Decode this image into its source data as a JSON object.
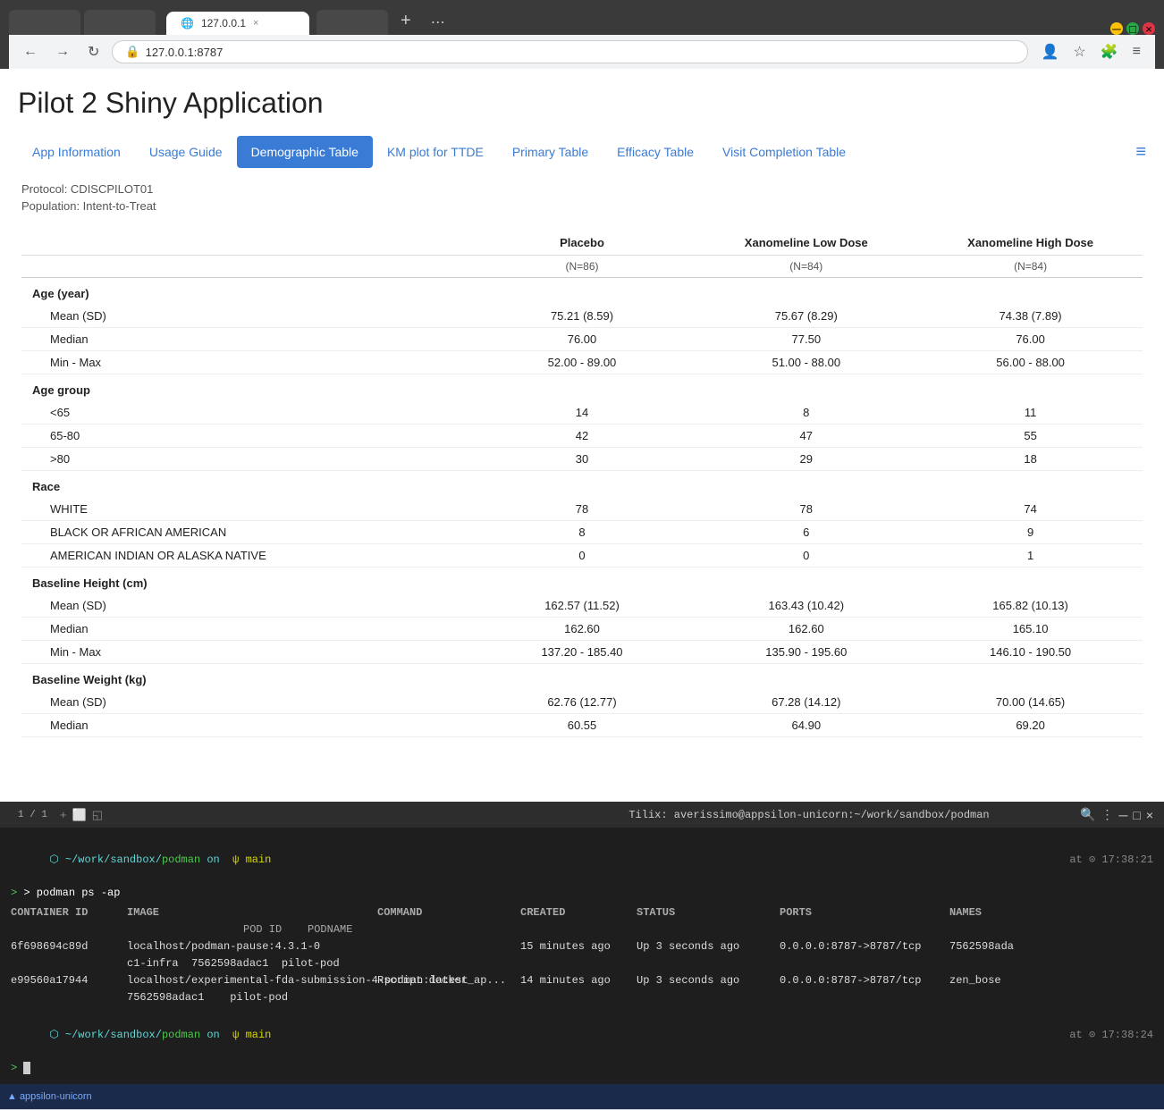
{
  "browser": {
    "tab_label": "127.0.0.1",
    "url": "127.0.0.1:8787",
    "tab_close": "×",
    "tab_new": "+",
    "tab_menu": "⋯",
    "nav_back": "←",
    "nav_forward": "→",
    "nav_refresh": "↻"
  },
  "app": {
    "title": "Pilot 2 Shiny Application",
    "tabs": [
      {
        "label": "App Information",
        "active": false
      },
      {
        "label": "Usage Guide",
        "active": false
      },
      {
        "label": "Demographic Table",
        "active": true
      },
      {
        "label": "KM plot for TTDE",
        "active": false
      },
      {
        "label": "Primary Table",
        "active": false
      },
      {
        "label": "Efficacy Table",
        "active": false
      },
      {
        "label": "Visit Completion Table",
        "active": false
      }
    ],
    "protocol": "Protocol: CDISCPILOT01",
    "population": "Population: Intent-to-Treat"
  },
  "table": {
    "columns": {
      "label": "",
      "placebo": "Placebo",
      "placebo_n": "(N=86)",
      "xan_low": "Xanomeline Low Dose",
      "xan_low_n": "(N=84)",
      "xan_high": "Xanomeline High Dose",
      "xan_high_n": "(N=84)"
    },
    "sections": [
      {
        "header": "Age (year)",
        "rows": [
          {
            "label": "Mean (SD)",
            "placebo": "75.21 (8.59)",
            "xan_low": "75.67 (8.29)",
            "xan_high": "74.38 (7.89)",
            "indented": true
          },
          {
            "label": "Median",
            "placebo": "76.00",
            "xan_low": "77.50",
            "xan_high": "76.00",
            "indented": true
          },
          {
            "label": "Min - Max",
            "placebo": "52.00 - 89.00",
            "xan_low": "51.00 - 88.00",
            "xan_high": "56.00 - 88.00",
            "indented": true
          }
        ]
      },
      {
        "header": "Age group",
        "rows": [
          {
            "label": "<65",
            "placebo": "14",
            "xan_low": "8",
            "xan_high": "11",
            "indented": true
          },
          {
            "label": "65-80",
            "placebo": "42",
            "xan_low": "47",
            "xan_high": "55",
            "indented": true
          },
          {
            "label": ">80",
            "placebo": "30",
            "xan_low": "29",
            "xan_high": "18",
            "indented": true
          }
        ]
      },
      {
        "header": "Race",
        "rows": [
          {
            "label": "WHITE",
            "placebo": "78",
            "xan_low": "78",
            "xan_high": "74",
            "indented": true
          },
          {
            "label": "BLACK OR AFRICAN AMERICAN",
            "placebo": "8",
            "xan_low": "6",
            "xan_high": "9",
            "indented": true
          },
          {
            "label": "AMERICAN INDIAN OR ALASKA NATIVE",
            "placebo": "0",
            "xan_low": "0",
            "xan_high": "1",
            "indented": true
          }
        ]
      },
      {
        "header": "Baseline Height (cm)",
        "rows": [
          {
            "label": "Mean (SD)",
            "placebo": "162.57 (11.52)",
            "xan_low": "163.43 (10.42)",
            "xan_high": "165.82 (10.13)",
            "indented": true
          },
          {
            "label": "Median",
            "placebo": "162.60",
            "xan_low": "162.60",
            "xan_high": "165.10",
            "indented": true
          },
          {
            "label": "Min - Max",
            "placebo": "137.20 - 185.40",
            "xan_low": "135.90 - 195.60",
            "xan_high": "146.10 - 190.50",
            "indented": true
          }
        ]
      },
      {
        "header": "Baseline Weight (kg)",
        "rows": [
          {
            "label": "Mean (SD)",
            "placebo": "62.76 (12.77)",
            "xan_low": "67.28 (14.12)",
            "xan_high": "70.00 (14.65)",
            "indented": true
          },
          {
            "label": "Median",
            "placebo": "60.55",
            "xan_low": "64.90",
            "xan_high": "69.20",
            "indented": true
          }
        ]
      }
    ]
  },
  "terminal": {
    "title": "Tilix: averissimo@appsilon-unicorn:~/work/sandbox/podman",
    "tab_label": "1 / 1",
    "line1": "~/work/sandbox/podman on  main",
    "line2": "> podman ps -ap",
    "col_headers": [
      "CONTAINER ID",
      "IMAGE",
      "COMMAND",
      "CREATED",
      "STATUS",
      "PORTS",
      "NAMES"
    ],
    "col_sub": [
      "",
      "POD ID    PODNAME",
      "",
      "",
      "",
      "",
      ""
    ],
    "rows": [
      {
        "container_id": "6f698694c89d",
        "image": "localhost/podman-pause:4.3.1-0",
        "command": "",
        "created": "15 minutes ago",
        "status": "Up 3 seconds ago",
        "ports": "0.0.0.0:8787->8787/tcp",
        "names": "7562598ada"
      },
      {
        "container_id": "",
        "image": "c1-infra  7562598adac1  pilot-pod",
        "command": "",
        "created": "",
        "status": "",
        "ports": "",
        "names": ""
      },
      {
        "container_id": "e99560a17944",
        "image": "localhost/experimental-fda-submission-4-podman:latest",
        "command": "Rscript docker_ap...",
        "created": "14 minutes ago",
        "status": "Up 3 seconds ago",
        "ports": "0.0.0.0:8787->8787/tcp",
        "names": "zen_bose"
      },
      {
        "container_id": "",
        "image": "7562598adac1    pilot-pod",
        "command": "",
        "created": "",
        "status": "",
        "ports": "",
        "names": ""
      }
    ],
    "line_last1": "~/work/sandbox/podman on  main",
    "line_last2": ">",
    "time1": "at ⊙ 17:38:21",
    "time2": "at ⊙ 17:38:24"
  }
}
